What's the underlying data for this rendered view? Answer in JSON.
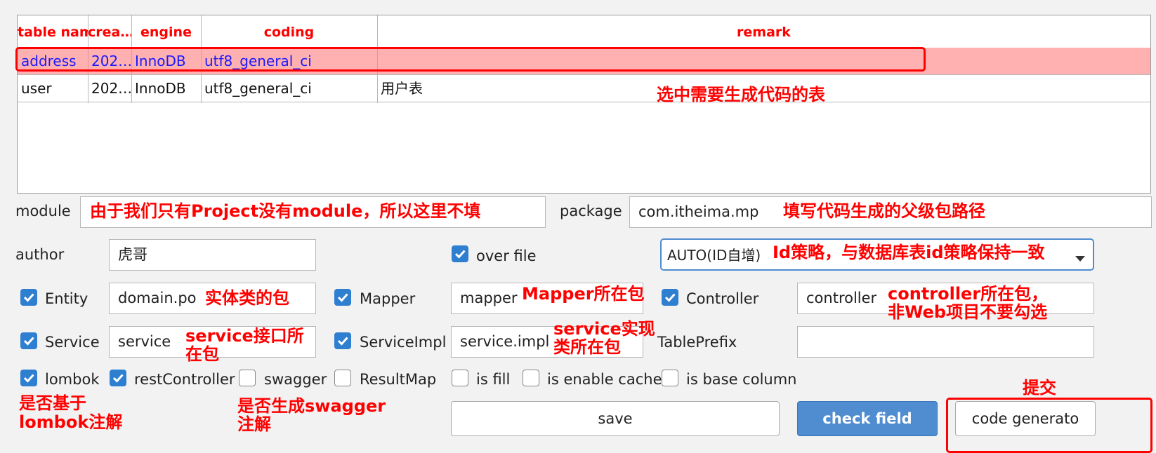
{
  "table": {
    "headers": [
      "table name",
      "crea…",
      "engine",
      "coding",
      "remark"
    ],
    "rows": [
      [
        "address",
        "202…",
        "InnoDB",
        "utf8_general_ci",
        ""
      ],
      [
        "user",
        "202…",
        "InnoDB",
        "utf8_general_ci",
        "用户表"
      ]
    ]
  },
  "form": {
    "module_label": "module",
    "module_value": "",
    "package_label": "package",
    "package_value": "com.itheima.mp",
    "author_label": "author",
    "author_value": "虎哥",
    "over_file_label": "over file",
    "id_type_value": "AUTO(ID自增)",
    "entity_label": "Entity",
    "entity_value": "domain.po",
    "mapper_label": "Mapper",
    "mapper_value": "mapper",
    "controller_label": "Controller",
    "controller_value": "controller",
    "service_label": "Service",
    "service_value": "service",
    "serviceimpl_label": "ServiceImpl",
    "serviceimpl_value": "service.impl",
    "tableprefix_label": "TablePrefix",
    "tableprefix_value": "",
    "lombok_label": "lombok",
    "restcontroller_label": "restController",
    "swagger_label": "swagger",
    "resultmap_label": "ResultMap",
    "isfill_label": "is fill",
    "cache_label": "is enable cache",
    "basecolumn_label": "is base column"
  },
  "checkboxes": {
    "over_file": true,
    "entity": true,
    "mapper": true,
    "controller": true,
    "service": true,
    "serviceimpl": true,
    "lombok": true,
    "restcontroller": true,
    "swagger": false,
    "resultmap": false,
    "isfill": false,
    "cache": false,
    "basecolumn": false
  },
  "buttons": {
    "save": "save",
    "check_field": "check field",
    "code_generator": "code generato"
  },
  "annotations": {
    "select_table": "选中需要生成代码的表",
    "module_note": "由于我们只有Project没有module，所以这里不填",
    "package_note": "填写代码生成的父级包路径",
    "id_note": "Id策略，与数据库表id策略保持一致",
    "entity_note": "实体类的包",
    "mapper_note": "Mapper所在包",
    "controller_note_1": "controller所在包，",
    "controller_note_2": "非Web项目不要勾选",
    "service_note_1": "service接口所",
    "service_note_2": "在包",
    "serviceimpl_note_1": "service实现",
    "serviceimpl_note_2": "类所在包",
    "lombok_note_1": "是否基于",
    "lombok_note_2": "lombok注解",
    "swagger_note_1": "是否生成swagger",
    "swagger_note_2": "注解",
    "submit_note": "提交"
  },
  "colors": {
    "selected_row": "#ffb0b0",
    "annotation_red": "#ff0000",
    "checkbox_blue": "#2f7fd1",
    "primary_button": "#4f8cd0"
  }
}
